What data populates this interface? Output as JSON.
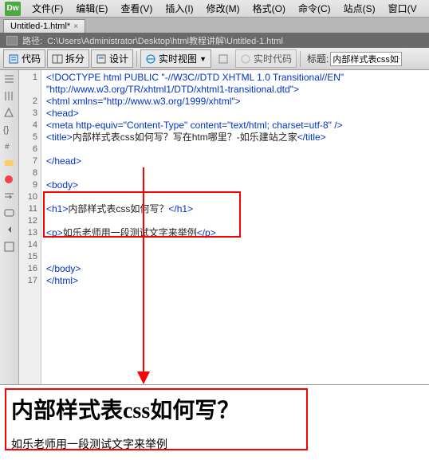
{
  "menubar": {
    "items": [
      "文件(F)",
      "编辑(E)",
      "查看(V)",
      "插入(I)",
      "修改(M)",
      "格式(O)",
      "命令(C)",
      "站点(S)",
      "窗口(V"
    ]
  },
  "tab": {
    "name": "Untitled-1.html*"
  },
  "pathbar": {
    "label": "路径:",
    "path": "C:\\Users\\Administrator\\Desktop\\html教程讲解\\Untitled-1.html"
  },
  "toolbar": {
    "code": "代码",
    "split": "拆分",
    "design": "设计",
    "live": "实时视图",
    "livecode": "实时代码",
    "titlelabel": "标题:",
    "titlevalue": "内部样式表css如何"
  },
  "code": {
    "l1a": "<!DOCTYPE html PUBLIC \"-//W3C//DTD XHTML 1.0 Transitional//EN\"",
    "l1b": "\"http://www.w3.org/TR/xhtml1/DTD/xhtml1-transitional.dtd\">",
    "l2": "<html xmlns=\"http://www.w3.org/1999/xhtml\">",
    "l3": "<head>",
    "l4": "<meta http-equiv=\"Content-Type\" content=\"text/html; charset=utf-8\" />",
    "l5a": "<title>",
    "l5b": "内部样式表css如何写？写在htm哪里？-如乐建站之家",
    "l5c": "</title>",
    "l7": "</head>",
    "l9": "<body>",
    "l11a": "<h1>",
    "l11b": "内部样式表css如何写？",
    "l11c": "</h1>",
    "l13a": "<p>",
    "l13b": "如乐老师用一段测试文字来举例",
    "l13c": "</p>",
    "l16": "</body>",
    "l17": "</html>"
  },
  "preview": {
    "h1": "内部样式表css如何写？",
    "p": "如乐老师用一段测试文字来举例"
  }
}
